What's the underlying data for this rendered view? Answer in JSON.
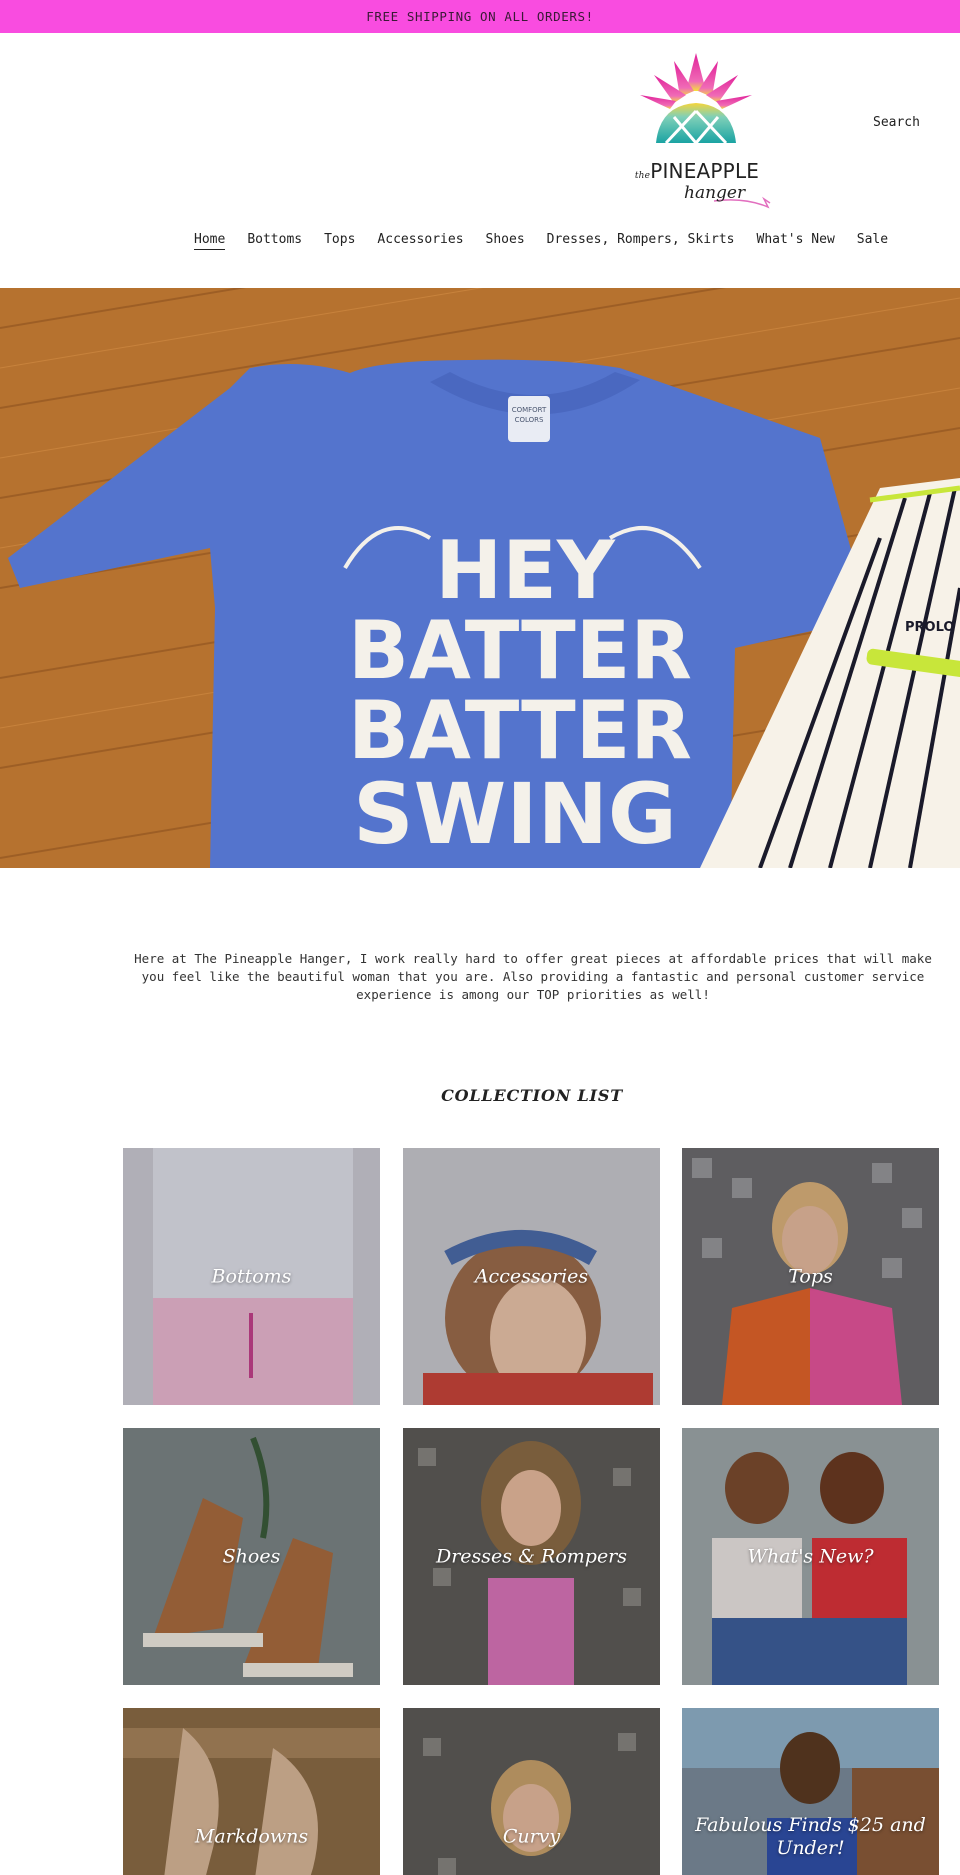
{
  "announcement": "FREE SHIPPING ON ALL ORDERS!",
  "brand": {
    "logo_the": "the",
    "logo_main": "PINEAPPLE",
    "logo_script": "hanger"
  },
  "header": {
    "search_label": "Search"
  },
  "nav": {
    "items": [
      {
        "label": "Home",
        "active": true
      },
      {
        "label": "Bottoms"
      },
      {
        "label": "Tops"
      },
      {
        "label": "Accessories"
      },
      {
        "label": "Shoes"
      },
      {
        "label": "Dresses, Rompers, Skirts"
      },
      {
        "label": "What's New"
      },
      {
        "label": "Sale"
      }
    ]
  },
  "hero": {
    "shirt_text": [
      "HEY",
      "BATTER",
      "BATTER",
      "SWING"
    ],
    "tag_text": [
      "COMFORT",
      "COLORS"
    ],
    "pants_text": "PROLO"
  },
  "intro_text": "Here at The Pineapple Hanger, I work really hard to offer great pieces at affordable prices that will make you feel like the beautiful woman that you are. Also providing a fantastic and personal customer service experience is among our  TOP priorities as well!",
  "collection": {
    "title": "COLLECTION LIST",
    "items": [
      {
        "label": "Bottoms"
      },
      {
        "label": "Accessories"
      },
      {
        "label": "Tops"
      },
      {
        "label": "Shoes"
      },
      {
        "label": "Dresses & Rompers"
      },
      {
        "label": "What's New?"
      },
      {
        "label": "Markdowns"
      },
      {
        "label": "Curvy"
      },
      {
        "label": "Fabulous Finds $25 and Under!"
      }
    ]
  },
  "colors": {
    "announcement_bg": "#f94ce0",
    "shirt": "#5474cd",
    "wood": "#b6722f"
  }
}
